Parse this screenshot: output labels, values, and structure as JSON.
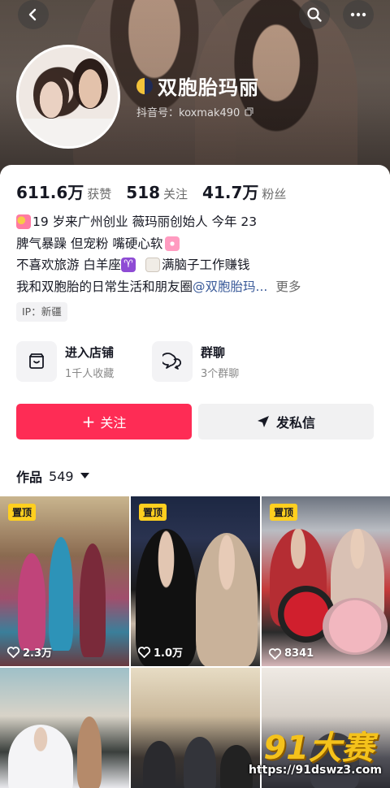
{
  "header": {
    "nickname": "双胞胎玛丽",
    "douyin_id": "抖音号：koxmak490",
    "icons": [
      "back-icon",
      "search-icon",
      "more-icon",
      "copy-icon"
    ]
  },
  "stats": [
    {
      "num": "611.6万",
      "label": "获赞"
    },
    {
      "num": "518",
      "label": "关注"
    },
    {
      "num": "41.7万",
      "label": "粉丝"
    }
  ],
  "bio": {
    "line1": "19 岁来广州创业  薇玛丽创始人  今年 23",
    "line2": "脾气暴躁 但宠粉  嘴硬心软",
    "line3a": "不喜欢旅游 白羊座",
    "line3b": "满脑子工作赚钱",
    "line4a": "我和双胞胎的日常生活和朋友圈 ",
    "line4_mention": "@双胞胎玛...",
    "more": "更多",
    "aries_glyph": "♈"
  },
  "ip": "IP：新疆",
  "entries": {
    "shop": {
      "title": "进入店铺",
      "sub": "1千人收藏"
    },
    "group": {
      "title": "群聊",
      "sub": "3个群聊"
    }
  },
  "actions": {
    "follow": "关注",
    "follow_plus": "+",
    "message": "发私信"
  },
  "works": {
    "label": "作品",
    "count": "549"
  },
  "videos": [
    {
      "pin": "置顶",
      "likes": "2.3万"
    },
    {
      "pin": "置顶",
      "likes": "1.0万"
    },
    {
      "pin": "置顶",
      "likes": "8341"
    }
  ],
  "watermark": {
    "logo": "91大赛",
    "url": "https://91dswz3.com"
  },
  "colors": {
    "accent": "#fe2c55",
    "pin": "#ffcf1f",
    "mention": "#3b5b9a"
  }
}
